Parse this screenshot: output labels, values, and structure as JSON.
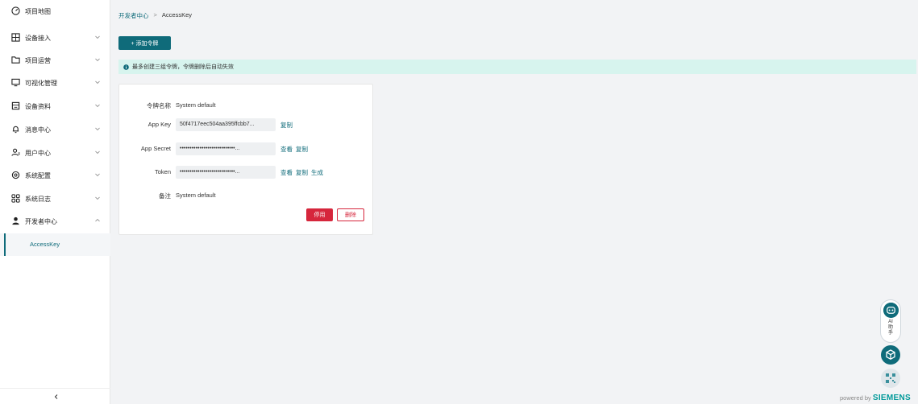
{
  "sidebar": {
    "items": [
      {
        "label": "项目地图",
        "icon": "dashboard-gauge-icon",
        "has_chevron": false
      },
      {
        "label": "设备接入",
        "icon": "device-grid-icon",
        "has_chevron": true
      },
      {
        "label": "项目运营",
        "icon": "folder-icon",
        "has_chevron": true
      },
      {
        "label": "可视化管理",
        "icon": "monitor-icon",
        "has_chevron": true
      },
      {
        "label": "设备资料",
        "icon": "document-icon",
        "has_chevron": true
      },
      {
        "label": "消息中心",
        "icon": "bell-icon",
        "has_chevron": true
      },
      {
        "label": "用户中心",
        "icon": "users-icon",
        "has_chevron": true
      },
      {
        "label": "系统配置",
        "icon": "gear-icon",
        "has_chevron": true
      },
      {
        "label": "系统日志",
        "icon": "apps-grid-icon",
        "has_chevron": true
      },
      {
        "label": "开发者中心",
        "icon": "developer-icon",
        "has_chevron": true,
        "expanded": true
      }
    ],
    "submenu_active": "AccessKey"
  },
  "breadcrumb": {
    "parent": "开发者中心",
    "separator": ">",
    "current": "AccessKey"
  },
  "toolbar": {
    "add_label": "+ 添加令牌"
  },
  "alert": {
    "text": "最多创建三组令牌，令牌删除后自动失效"
  },
  "token_card": {
    "name_label": "令牌名称",
    "name_value": "System default",
    "app_key_label": "App Key",
    "app_key_value": "50f4717eec504aa395ffcbb7...",
    "app_key_copy": "复制",
    "app_secret_label": "App Secret",
    "app_secret_value": "••••••••••••••••••••••••••••...",
    "app_secret_view": "查看",
    "app_secret_copy": "复制",
    "token_label": "Token",
    "token_value": "••••••••••••••••••••••••••••...",
    "token_view": "查看",
    "token_copy": "复制",
    "token_generate": "生成",
    "remark_label": "备注",
    "remark_value": "System default",
    "disable_label": "停用",
    "delete_label": "删除"
  },
  "assistant": {
    "label_line1": "AI",
    "label_line2": "助",
    "label_line3": "手"
  },
  "footer": {
    "powered": "powered by",
    "brand": "SIEMENS"
  },
  "colors": {
    "primary": "#0f6b7a",
    "danger": "#d6263c",
    "alert_bg": "#d7f4ee",
    "brand": "#009999"
  }
}
